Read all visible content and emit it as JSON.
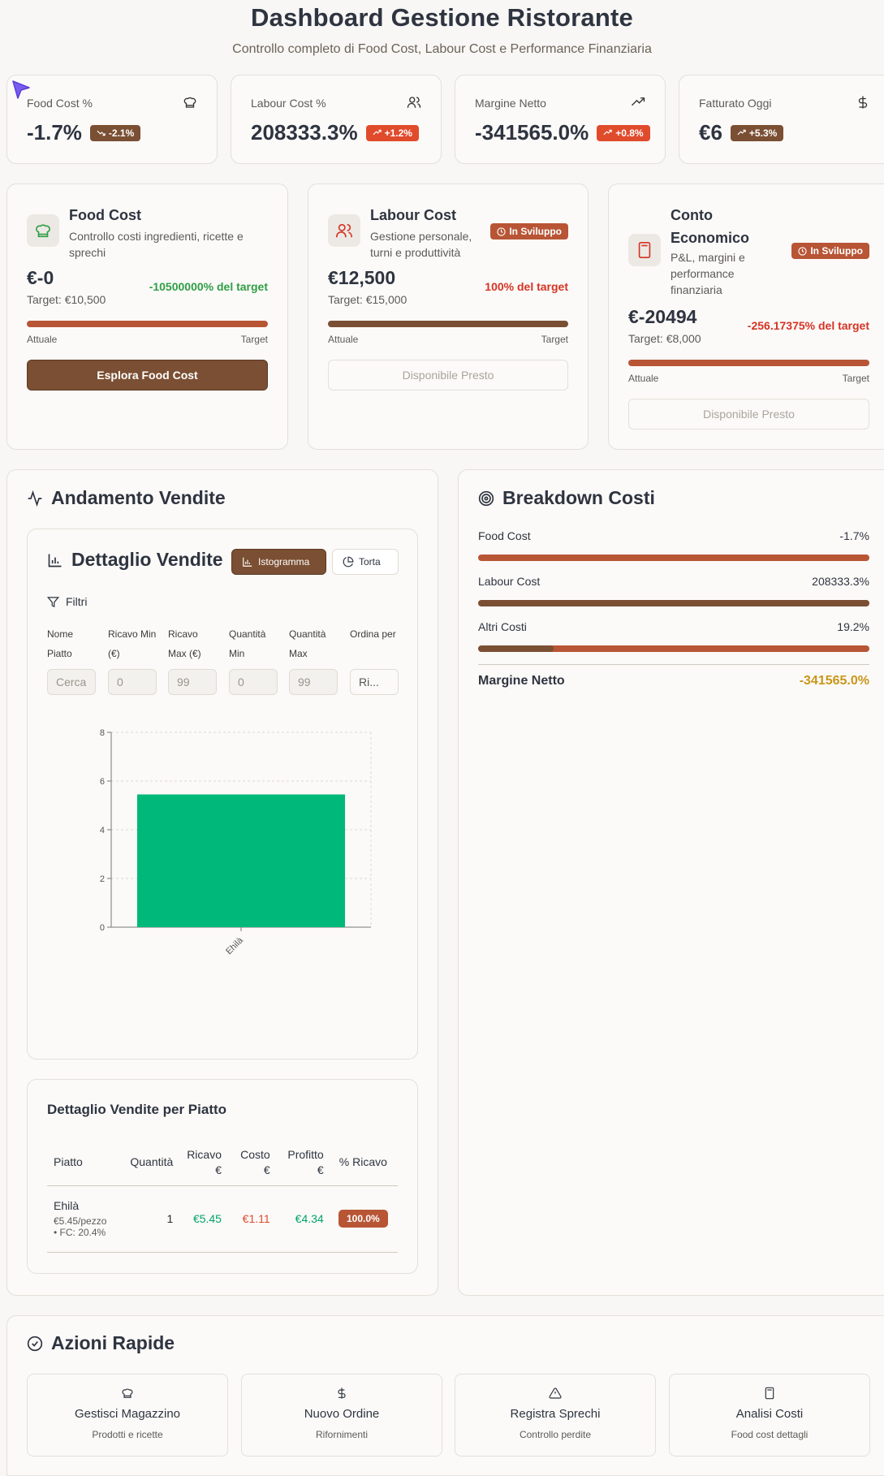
{
  "header": {
    "title": "Dashboard Gestione Ristorante",
    "subtitle": "Controllo completo di Food Cost, Labour Cost e Performance Finanziaria"
  },
  "kpis": [
    {
      "label": "Food Cost %",
      "value": "-1.7%",
      "trend": "-2.1%",
      "trend_color": "#7b4f33",
      "icon": "chef-hat-icon"
    },
    {
      "label": "Labour Cost %",
      "value": "208333.3%",
      "trend": "+1.2%",
      "trend_color": "#e04b2c",
      "icon": "users-icon"
    },
    {
      "label": "Margine Netto",
      "value": "-341565.0%",
      "trend": "+0.8%",
      "trend_color": "#e04b2c",
      "icon": "trending-up-icon"
    },
    {
      "label": "Fatturato Oggi",
      "value": "€6",
      "trend": "+5.3%",
      "trend_color": "#7b4f33",
      "icon": "dollar-icon"
    }
  ],
  "modules": [
    {
      "title": "Food Cost",
      "description": "Controllo costi ingredienti, ricette e sprechi",
      "amount": "€-0",
      "target": "Target: €10,500",
      "pct": "-10500000% del target",
      "pct_color": "#2f9e44",
      "bar_left": "Attuale",
      "bar_right": "Target",
      "progress": 1.0,
      "button": "Esplora Food Cost"
    },
    {
      "title": "Labour Cost",
      "description": "Gestione personale, turni e produttività",
      "badge": "In Sviluppo",
      "amount": "€12,500",
      "target": "Target: €15,000",
      "pct": "100% del target",
      "pct_color": "#d63324",
      "bar_left": "Attuale",
      "bar_right": "Target",
      "progress": 1.0,
      "button": "Disponibile Presto"
    },
    {
      "title": "Conto Economico",
      "description": "P&L, margini e performance finanziaria",
      "badge": "In Sviluppo",
      "amount": "€-20494",
      "target": "Target: €8,000",
      "pct": "-256.17375% del target",
      "pct_color": "#d63324",
      "bar_left": "Attuale",
      "bar_right": "Target",
      "progress": 1.0,
      "button": "Disponibile Presto"
    }
  ],
  "sales": {
    "title": "Andamento Vendite",
    "detail_title": "Dettaglio Vendite",
    "toggle_bar": "Istogramma",
    "toggle_pie": "Torta",
    "filters_label": "Filtri",
    "filters": [
      {
        "label": "Nome Piatto",
        "value": "Cerca"
      },
      {
        "label": "Ricavo Min (€)",
        "value": "0"
      },
      {
        "label": "Ricavo Max (€)",
        "value": "99"
      },
      {
        "label": "Quantità Min",
        "value": "0"
      },
      {
        "label": "Quantità Max",
        "value": "99"
      },
      {
        "label": "Ordina per",
        "value": "Ri..."
      }
    ],
    "table_title": "Dettaglio Vendite per Piatto",
    "columns": [
      "Piatto",
      "Quantità",
      "Ricavo €",
      "Costo €",
      "Profitto €",
      "% Ricavo"
    ],
    "rows": [
      {
        "name": "Ehilà",
        "sub1": "€5.45/pezzo",
        "sub2": "• FC: 20.4%",
        "qty": "1",
        "revenue": "€5.45",
        "cost": "€1.11",
        "profit": "€4.34",
        "pct": "100.0%"
      }
    ]
  },
  "chart_data": {
    "type": "bar",
    "categories": [
      "Ehilà"
    ],
    "values": [
      5.45
    ],
    "title": "",
    "xlabel": "",
    "ylabel": "",
    "ylim": [
      0,
      8
    ],
    "yticks": [
      0,
      2,
      4,
      6,
      8
    ],
    "grid": true,
    "bar_color": "#00b87a"
  },
  "breakdown": {
    "title": "Breakdown Costi",
    "items": [
      {
        "label": "Food Cost",
        "value": "-1.7%",
        "fill": 0.0,
        "fill_color": "#7b4f33"
      },
      {
        "label": "Labour Cost",
        "value": "208333.3%",
        "fill": 1.0,
        "fill_color": "#7b4f33"
      },
      {
        "label": "Altri Costi",
        "value": "19.2%",
        "fill": 0.192,
        "fill_color": "#7b4f33"
      }
    ],
    "net_label": "Margine Netto",
    "net_value": "-341565.0%"
  },
  "quick_actions": {
    "title": "Azioni Rapide",
    "items": [
      {
        "title": "Gestisci Magazzino",
        "subtitle": "Prodotti e ricette",
        "icon": "chef-hat-icon"
      },
      {
        "title": "Nuovo Ordine",
        "subtitle": "Rifornimenti",
        "icon": "dollar-icon"
      },
      {
        "title": "Registra Sprechi",
        "subtitle": "Controllo perdite",
        "icon": "warning-icon"
      },
      {
        "title": "Analisi Costi",
        "subtitle": "Food cost dettagli",
        "icon": "calculator-icon"
      }
    ]
  },
  "colors": {
    "brown": "#7b4f33",
    "rust": "#b85535",
    "green": "#00b87a",
    "red": "#e04b2c",
    "gold": "#c9961a"
  }
}
